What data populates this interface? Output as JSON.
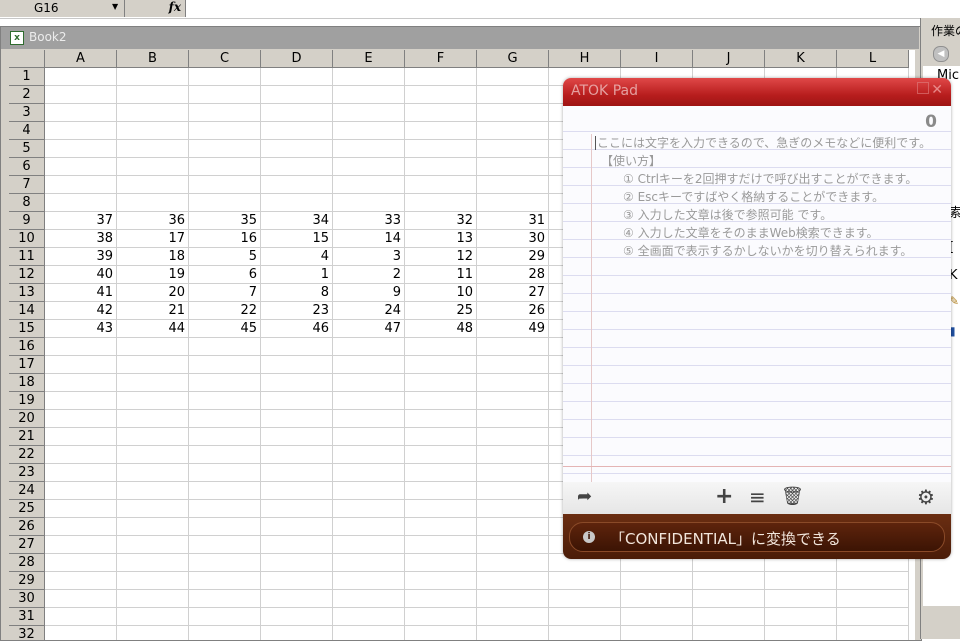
{
  "formula_bar": {
    "namebox_value": "G16",
    "dropdown_glyph": "▼",
    "fx_label": "fx"
  },
  "workbook": {
    "title": "Book2",
    "icon": "excel-doc-icon",
    "columns": [
      "A",
      "B",
      "C",
      "D",
      "E",
      "F",
      "G",
      "H",
      "I",
      "J",
      "K",
      "L"
    ],
    "row_numbers": [
      "1",
      "2",
      "3",
      "4",
      "5",
      "6",
      "7",
      "8",
      "9",
      "10",
      "11",
      "12",
      "13",
      "14",
      "15",
      "16",
      "17",
      "18",
      "19",
      "20",
      "21",
      "22",
      "23",
      "24",
      "25",
      "26",
      "27",
      "28",
      "29",
      "30",
      "31",
      "32"
    ],
    "data_rows": [
      {
        "row": "9",
        "cells": [
          "37",
          "36",
          "35",
          "34",
          "33",
          "32",
          "31"
        ]
      },
      {
        "row": "10",
        "cells": [
          "38",
          "17",
          "16",
          "15",
          "14",
          "13",
          "30"
        ]
      },
      {
        "row": "11",
        "cells": [
          "39",
          "18",
          "5",
          "4",
          "3",
          "12",
          "29"
        ]
      },
      {
        "row": "12",
        "cells": [
          "40",
          "19",
          "6",
          "1",
          "2",
          "11",
          "28"
        ]
      },
      {
        "row": "13",
        "cells": [
          "41",
          "20",
          "7",
          "8",
          "9",
          "10",
          "27"
        ]
      },
      {
        "row": "14",
        "cells": [
          "42",
          "21",
          "22",
          "23",
          "24",
          "25",
          "26"
        ]
      },
      {
        "row": "15",
        "cells": [
          "43",
          "44",
          "45",
          "46",
          "47",
          "48",
          "49"
        ]
      }
    ]
  },
  "task_pane": {
    "title": "作業の",
    "nav_icon": "back-arrow-icon",
    "item_mic": "Mic",
    "frag1": "索",
    "frag2": "[",
    "frag3": "K"
  },
  "atok_pad": {
    "title": "ATOK Pad",
    "char_count": "0",
    "lines": [
      "ここには文字を入力できるので、急ぎのメモなどに便利です。",
      "【使い方】",
      "① Ctrlキーを2回押すだけで呼び出すことができます。",
      "② Escキーですばやく格納することができます。",
      "③ 入力した文章は後で参照可能 です。",
      "④ 入力した文章をそのままWeb検索できます。",
      "⑤ 全画面で表示するかしないかを切り替えられます。"
    ],
    "toolbar": {
      "share_icon": "share-icon",
      "add_icon": "add-icon",
      "list_icon": "list-icon",
      "trash_icon": "trash-icon",
      "settings_icon": "gear-icon"
    },
    "hint": "「CONFIDENTIAL」に変換できる",
    "colors": {
      "title_bar": "#b81e1e",
      "footer": "#4a1c08"
    }
  }
}
